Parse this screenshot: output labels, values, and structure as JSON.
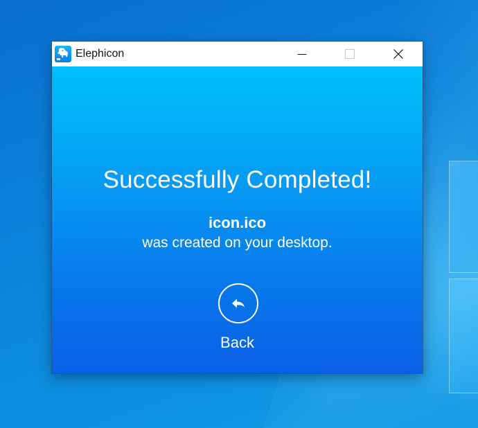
{
  "window": {
    "title": "Elephicon",
    "app_icon": "elephant-icon",
    "controls": {
      "minimize_icon": "minimize-icon",
      "maximize_icon": "maximize-icon",
      "close_icon": "close-icon"
    }
  },
  "main": {
    "headline": "Successfully Completed!",
    "filename": "icon.ico",
    "message": "was created on your desktop.",
    "back_icon": "reply-arrow-icon",
    "back_label": "Back"
  },
  "colors": {
    "gradient_top": "#00c0fb",
    "gradient_bottom": "#0a5fe6",
    "text": "#ffffff",
    "titlebar": "#ffffff"
  }
}
